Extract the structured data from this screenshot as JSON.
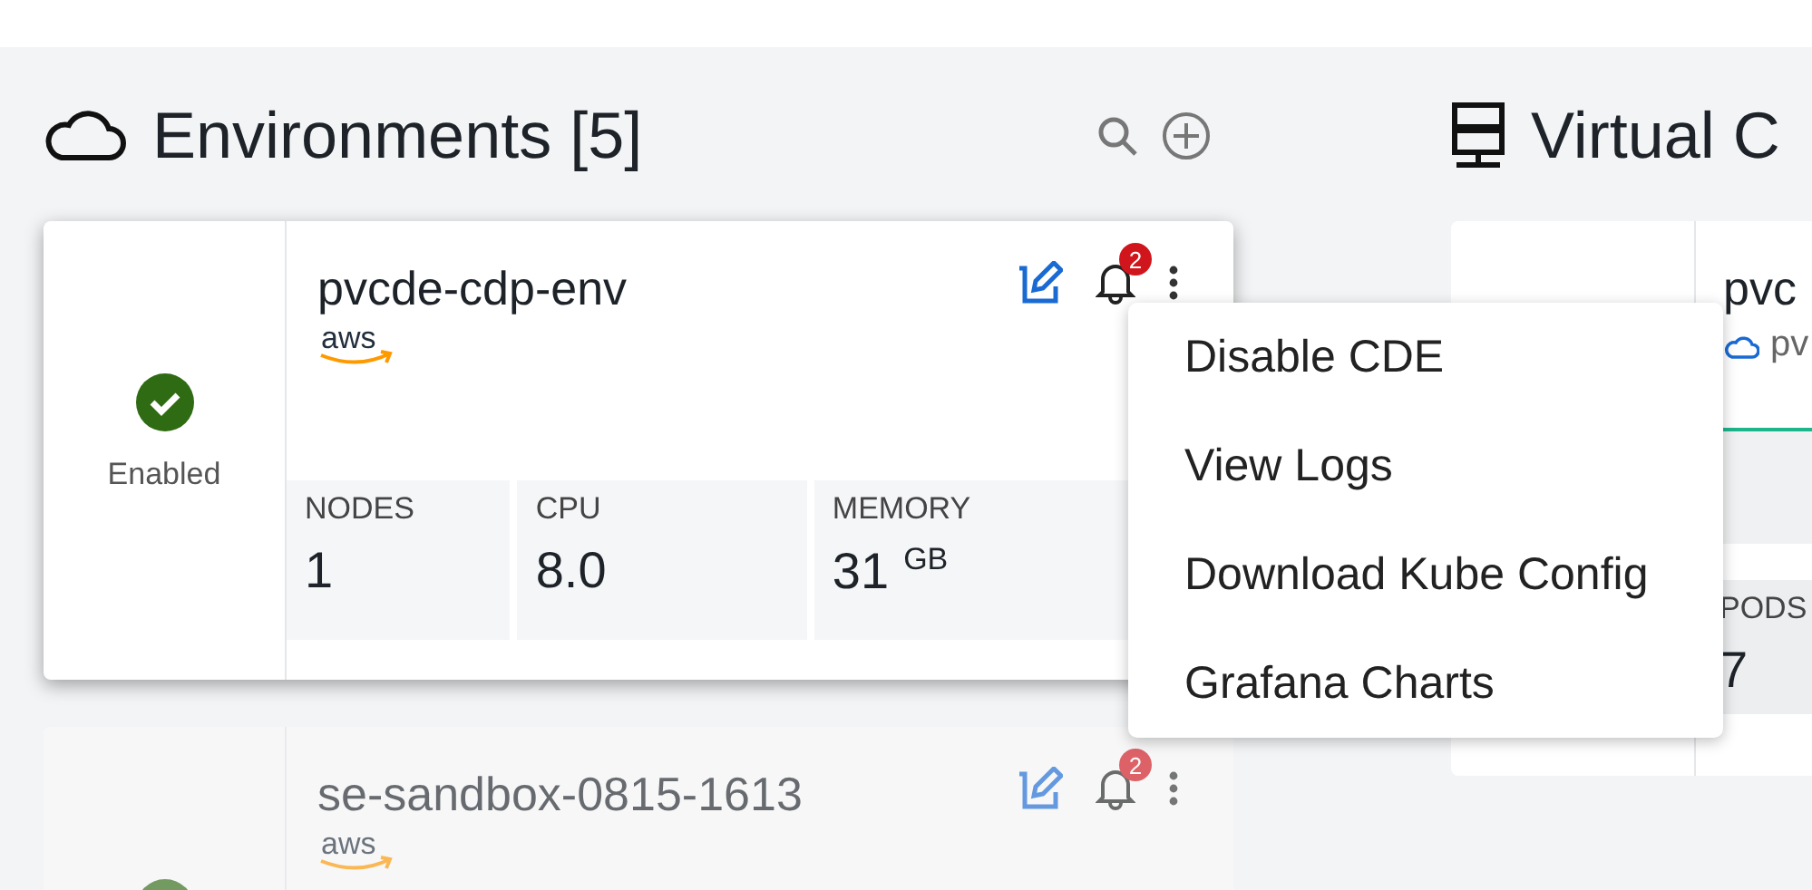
{
  "environments": {
    "title": "Environments [5]",
    "cards": [
      {
        "name": "pvcde-cdp-env",
        "provider": "aws",
        "status": "Enabled",
        "notifications": "2",
        "dimmed": false,
        "stats": [
          {
            "label": "NODES",
            "value": "1"
          },
          {
            "label": "CPU",
            "value": "8.0"
          },
          {
            "label": "MEMORY",
            "value": "31",
            "unit": "GB"
          }
        ]
      },
      {
        "name": "se-sandbox-0815-1613",
        "provider": "aws",
        "notifications": "2",
        "dimmed": true
      }
    ]
  },
  "menu": {
    "items": [
      "Disable CDE",
      "View Logs",
      "Download Kube Config",
      "Grafana Charts"
    ]
  },
  "virtual_clusters": {
    "title": "Virtual C",
    "card": {
      "name": "pvc",
      "environment": "pv",
      "stats": [
        {
          "label": "PODS",
          "value": "7"
        }
      ]
    }
  }
}
